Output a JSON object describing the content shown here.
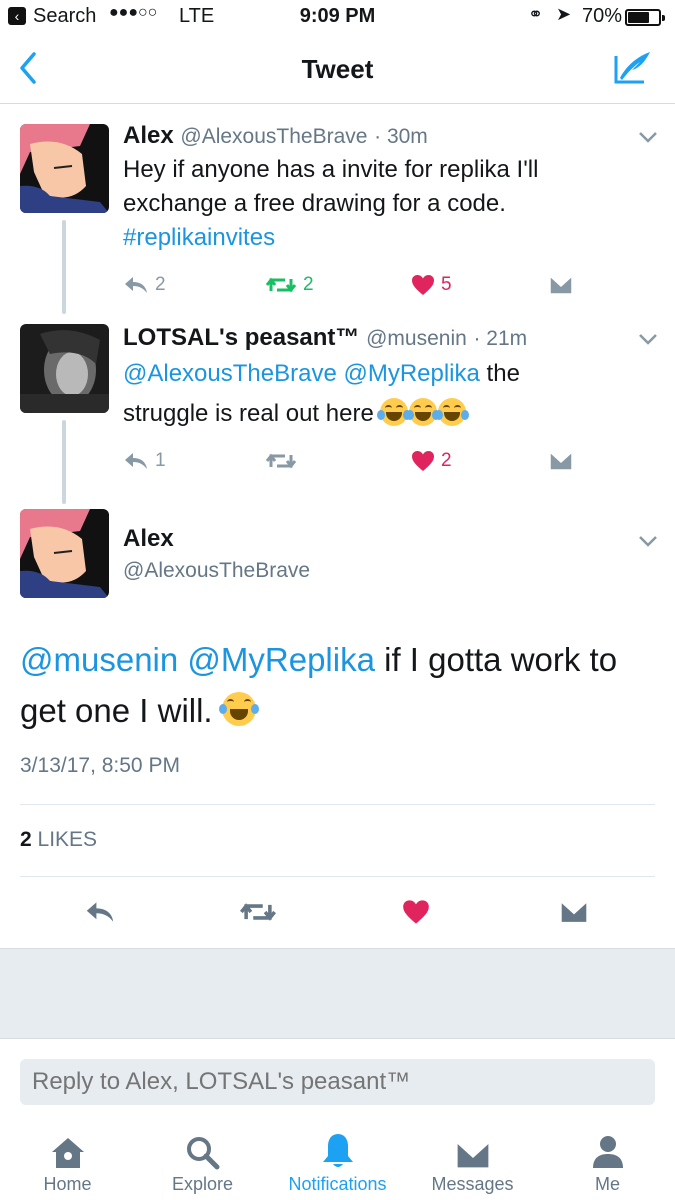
{
  "status_bar": {
    "back_app": "Search",
    "carrier": "LTE",
    "signal": "●●●○○",
    "time": "9:09 PM",
    "battery": "70%",
    "battery_level": 0.7
  },
  "nav": {
    "title": "Tweet"
  },
  "tweets": [
    {
      "name": "Alex",
      "handle": "@AlexousTheBrave",
      "time": "· 30m",
      "text_line1": "Hey if anyone has a invite for replika I'll",
      "text_line2": "exchange a free drawing for a code.",
      "hashtag": "#replikainvites",
      "replies": "2",
      "retweets": "2",
      "likes": "5"
    },
    {
      "name": "LOTSAL's peasant™",
      "handle": "@musenin",
      "time": "· 21m",
      "mention1": "@AlexousTheBrave",
      "mention2": "@MyReplika",
      "text_after": "the",
      "text_line2": "struggle is real out here",
      "replies": "1",
      "retweets": "",
      "likes": "2"
    }
  ],
  "main_tweet": {
    "name": "Alex",
    "handle": "@AlexousTheBrave",
    "mention1": "@musenin",
    "mention2": "@MyReplika",
    "text_after": "if I gotta work to",
    "text_line2": "get one I will.",
    "timestamp": "3/13/17, 8:50 PM",
    "likes_count": "2",
    "likes_label": "LIKES"
  },
  "reply": {
    "placeholder": "Reply to Alex, LOTSAL's peasant™"
  },
  "tabs": [
    {
      "label": "Home",
      "icon": "home-icon"
    },
    {
      "label": "Explore",
      "icon": "search-icon"
    },
    {
      "label": "Notifications",
      "icon": "bell-icon"
    },
    {
      "label": "Messages",
      "icon": "envelope-icon"
    },
    {
      "label": "Me",
      "icon": "person-icon"
    }
  ],
  "colors": {
    "accent": "#1da1f2",
    "link": "#1b95e0",
    "retweet": "#17bf63",
    "like": "#e0245e"
  }
}
